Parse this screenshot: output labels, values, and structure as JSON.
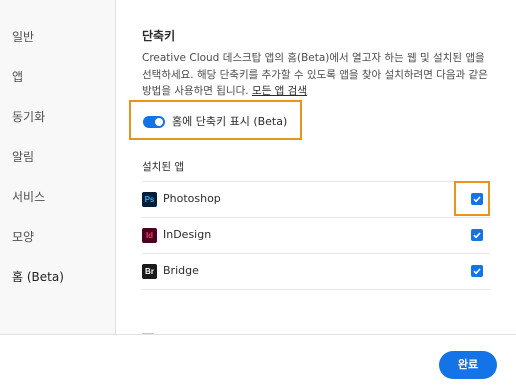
{
  "sidebar": {
    "items": [
      {
        "label": "일반"
      },
      {
        "label": "앱"
      },
      {
        "label": "동기화"
      },
      {
        "label": "알림"
      },
      {
        "label": "서비스"
      },
      {
        "label": "모양"
      },
      {
        "label": "홈 (Beta)",
        "active": true
      }
    ]
  },
  "main": {
    "section_title": "단축키",
    "description": "Creative Cloud 데스크탑 앱의 홈(Beta)에서 열고자 하는 웹 및 설치된 앱을 선택하세요. 해당 단축키를 추가할 수 있도록 앱을 찾아 설치하려면 다음과 같은 방법을 사용하면 됩니다.",
    "description_link": "모든 앱 검색",
    "toggle": {
      "label": "홈에 단축키 표시 (Beta)",
      "on": true
    },
    "installed_title": "설치된 앱",
    "apps": [
      {
        "icon_text": "Ps",
        "icon": "photoshop-icon",
        "name": "Photoshop",
        "checked": true
      },
      {
        "icon_text": "Id",
        "icon": "indesign-icon",
        "name": "InDesign",
        "checked": true
      },
      {
        "icon_text": "Br",
        "icon": "bridge-icon",
        "name": "Bridge",
        "checked": true
      }
    ]
  },
  "footer": {
    "done_label": "완료"
  },
  "colors": {
    "accent": "#1473e6",
    "highlight": "#e8951f"
  }
}
